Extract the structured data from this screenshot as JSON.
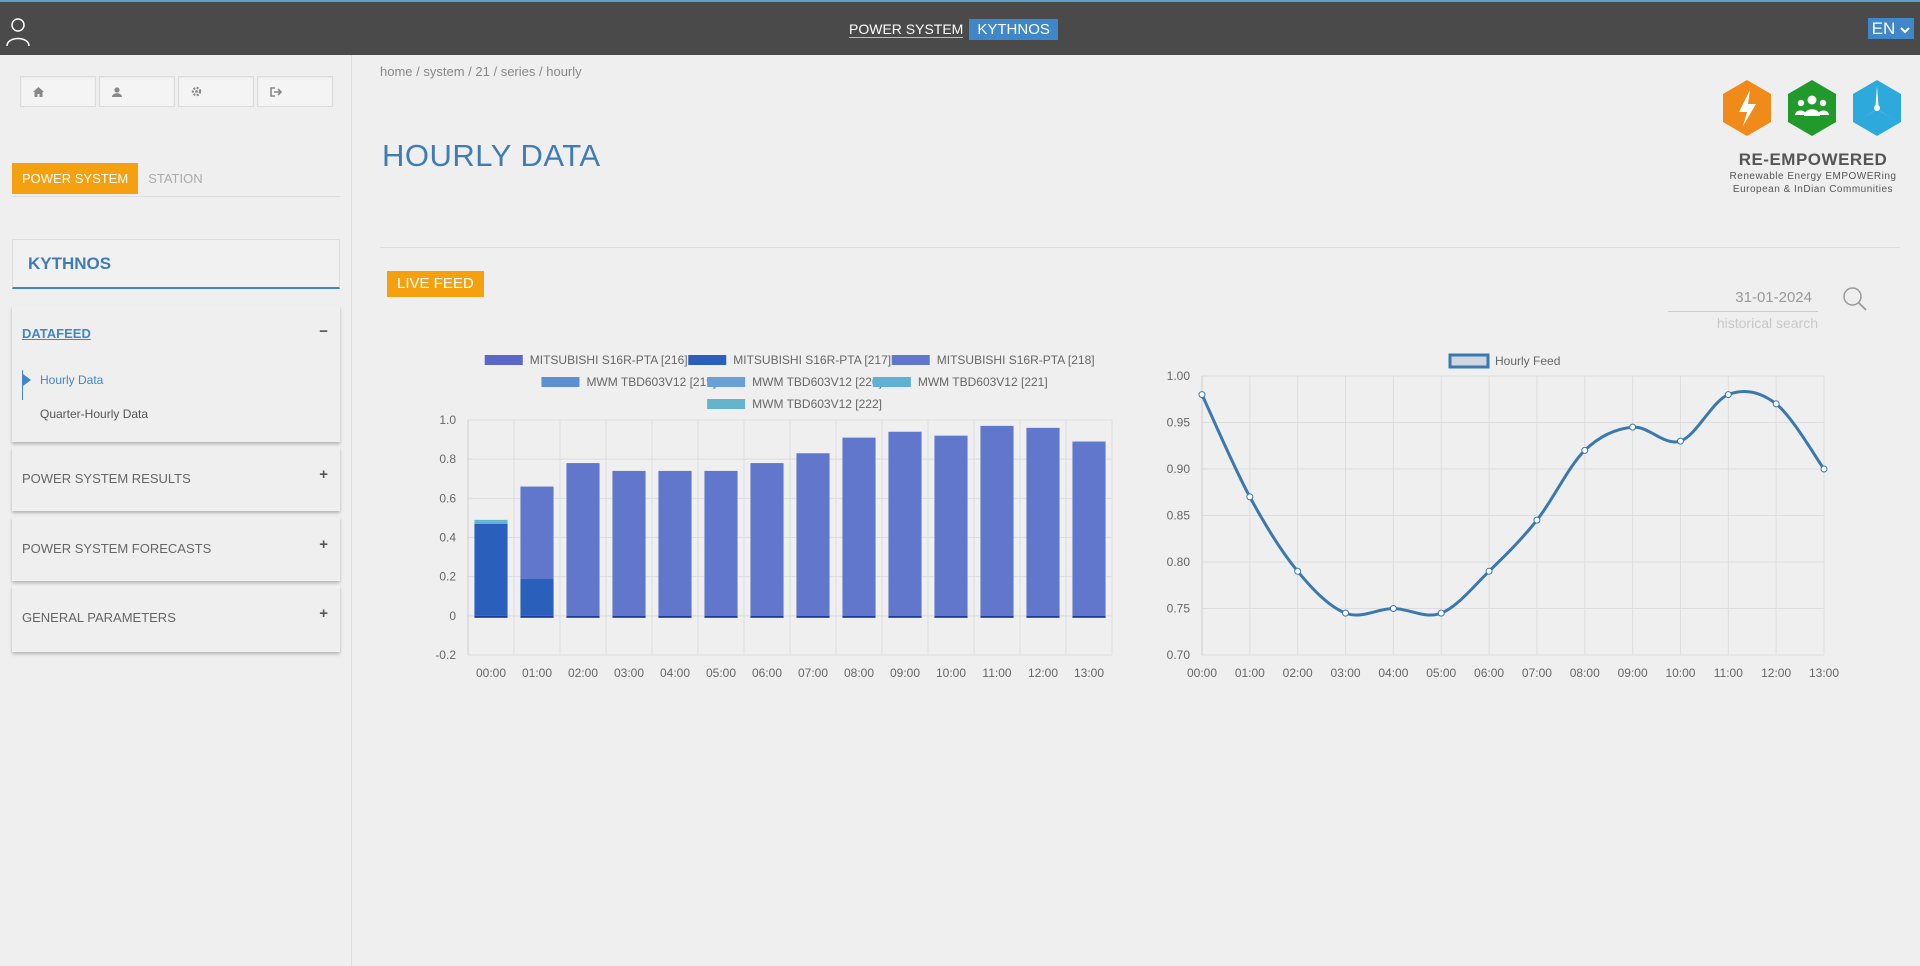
{
  "topbar": {
    "brand_label": "POWER SYSTEM",
    "system_name": "KYTHNOS",
    "language": "EN"
  },
  "sidebar": {
    "quick_buttons": [
      {
        "icon": "home-icon"
      },
      {
        "icon": "user-icon"
      },
      {
        "icon": "gear-icon"
      },
      {
        "icon": "sign-out-icon"
      }
    ],
    "tabs": {
      "power_system": "POWER SYSTEM",
      "station": "STATION"
    },
    "system_title": "KYTHNOS",
    "sections": {
      "datafeed": {
        "label": "DATAFEED",
        "items": [
          "Hourly Data",
          "Quarter-Hourly Data"
        ]
      },
      "results": "POWER SYSTEM RESULTS",
      "forecasts": "POWER SYSTEM FORECASTS",
      "parameters": "GENERAL PARAMETERS"
    }
  },
  "breadcrumb": [
    "home",
    "system",
    "21",
    "series",
    "hourly"
  ],
  "page_title": "HOURLY DATA",
  "logo": {
    "name": "RE-EMPOWERED",
    "tagline_1": "Renewable Energy EMPOWERing",
    "tagline_2": "European & InDian Communities",
    "colors": [
      "#f08a1a",
      "#1f9a2b",
      "#2ea9dc"
    ]
  },
  "live_feed_label": "LIVE FEED",
  "search": {
    "date_value": "31-01-2024",
    "hint": "historical search"
  },
  "chart_data": [
    {
      "type": "bar",
      "stacked": true,
      "categories": [
        "00:00",
        "01:00",
        "02:00",
        "03:00",
        "04:00",
        "05:00",
        "06:00",
        "07:00",
        "08:00",
        "09:00",
        "10:00",
        "11:00",
        "12:00",
        "13:00"
      ],
      "ylim": [
        -0.2,
        1.0
      ],
      "yticks": [
        "1.0",
        "0.8",
        "0.6",
        "0.4",
        "0.2",
        "0",
        "-0.2"
      ],
      "grid": true,
      "legend_position": "top",
      "series": [
        {
          "name": "MITSUBISHI S16R-PTA [216]",
          "color": "#5a67c6",
          "values": [
            0,
            0,
            0,
            0,
            0,
            0,
            0,
            0,
            0,
            0,
            0,
            0,
            0,
            0
          ]
        },
        {
          "name": "MITSUBISHI S16R-PTA [217]",
          "color": "#2a5fbc",
          "values": [
            0.47,
            0.19,
            0,
            0,
            0,
            0,
            0,
            0,
            0,
            0,
            0,
            0,
            0,
            0
          ]
        },
        {
          "name": "MITSUBISHI S16R-PTA [218]",
          "color": "#6077cb",
          "values": [
            0,
            0.47,
            0.78,
            0.74,
            0.74,
            0.74,
            0.78,
            0.83,
            0.91,
            0.94,
            0.92,
            0.97,
            0.96,
            0.89
          ]
        },
        {
          "name": "MWM TBD603V12 [219]",
          "color": "#5e8fd0",
          "values": [
            0,
            0,
            0,
            0,
            0,
            0,
            0,
            0,
            0,
            0,
            0,
            0,
            0,
            0
          ]
        },
        {
          "name": "MWM TBD603V12 [220]",
          "color": "#6aa0d8",
          "values": [
            0,
            0,
            0,
            0,
            0,
            0,
            0,
            0,
            0,
            0,
            0,
            0,
            0,
            0
          ]
        },
        {
          "name": "MWM TBD603V12 [221]",
          "color": "#5fb0d6",
          "values": [
            0.01,
            0,
            0,
            0,
            0,
            0,
            0,
            0,
            0,
            0,
            0,
            0,
            0,
            0
          ]
        },
        {
          "name": "MWM TBD603V12 [222]",
          "color": "#64b4cc",
          "values": [
            0.01,
            0,
            0,
            0,
            0,
            0,
            0,
            0,
            0,
            0,
            0,
            0,
            0,
            0
          ]
        }
      ]
    },
    {
      "type": "line",
      "x": [
        "00:00",
        "01:00",
        "02:00",
        "03:00",
        "04:00",
        "05:00",
        "06:00",
        "07:00",
        "08:00",
        "09:00",
        "10:00",
        "11:00",
        "12:00",
        "13:00"
      ],
      "ylim": [
        0.7,
        1.0
      ],
      "yticks": [
        "1.00",
        "0.95",
        "0.90",
        "0.85",
        "0.80",
        "0.75",
        "0.70"
      ],
      "grid": true,
      "legend_position": "top",
      "series": [
        {
          "name": "Hourly Feed",
          "color": "#3a78b0",
          "values": [
            0.98,
            0.87,
            0.79,
            0.745,
            0.75,
            0.745,
            0.79,
            0.845,
            0.92,
            0.945,
            0.93,
            0.98,
            0.97,
            0.9
          ]
        }
      ]
    }
  ]
}
